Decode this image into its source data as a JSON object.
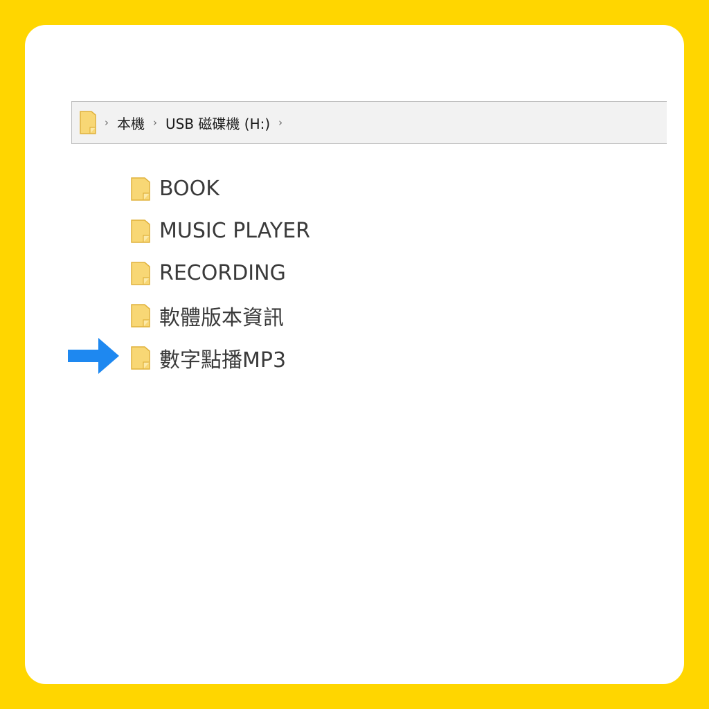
{
  "colors": {
    "background": "#ffd600",
    "card": "#ffffff",
    "folder_fill": "#f8d775",
    "folder_edge": "#e0b23c",
    "arrow": "#1e88f0"
  },
  "breadcrumb": {
    "root_icon": "folder-icon",
    "items": [
      "本機",
      "USB 磁碟機 (H:)"
    ],
    "separator": "›"
  },
  "files": [
    {
      "name": "BOOK",
      "icon": "folder-icon"
    },
    {
      "name": "MUSIC PLAYER",
      "icon": "folder-icon"
    },
    {
      "name": "RECORDING",
      "icon": "folder-icon"
    },
    {
      "name": "軟體版本資訊",
      "icon": "folder-icon"
    },
    {
      "name": "數字點播MP3",
      "icon": "folder-icon",
      "highlighted": true
    }
  ],
  "pointer": {
    "icon": "arrow-right-icon",
    "points_to": "數字點播MP3"
  }
}
